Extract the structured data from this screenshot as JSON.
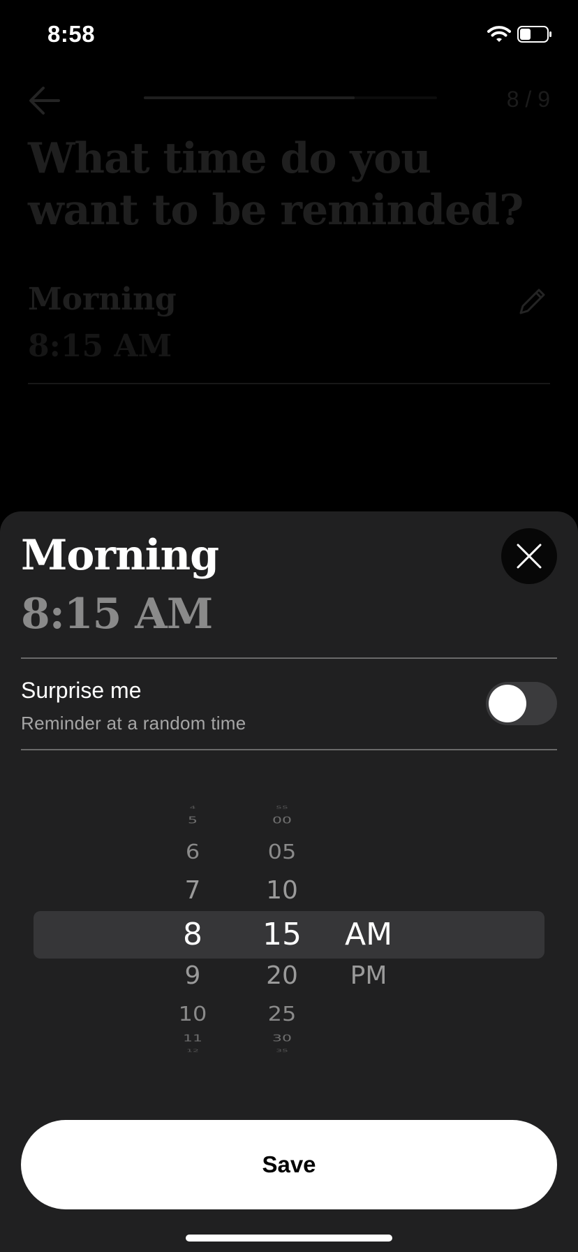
{
  "status_bar": {
    "time": "8:58"
  },
  "background": {
    "step": "8 / 9",
    "progress": 0.72,
    "question": "What time do you want to be reminded?",
    "reminder_label": "Morning",
    "reminder_time": "8:15 AM"
  },
  "sheet": {
    "title": "Morning",
    "time": "8:15 AM",
    "surprise_title": "Surprise me",
    "surprise_subtitle": "Reminder at a random time",
    "surprise_enabled": false,
    "picker": {
      "hours": [
        "4",
        "5",
        "6",
        "7",
        "8",
        "9",
        "10",
        "11",
        "12"
      ],
      "minutes": [
        "55",
        "00",
        "05",
        "10",
        "15",
        "20",
        "25",
        "30",
        "35"
      ],
      "periods": [
        "AM",
        "PM"
      ],
      "selected_hour": "8",
      "selected_minute": "15",
      "selected_period": "AM"
    },
    "save_label": "Save"
  }
}
